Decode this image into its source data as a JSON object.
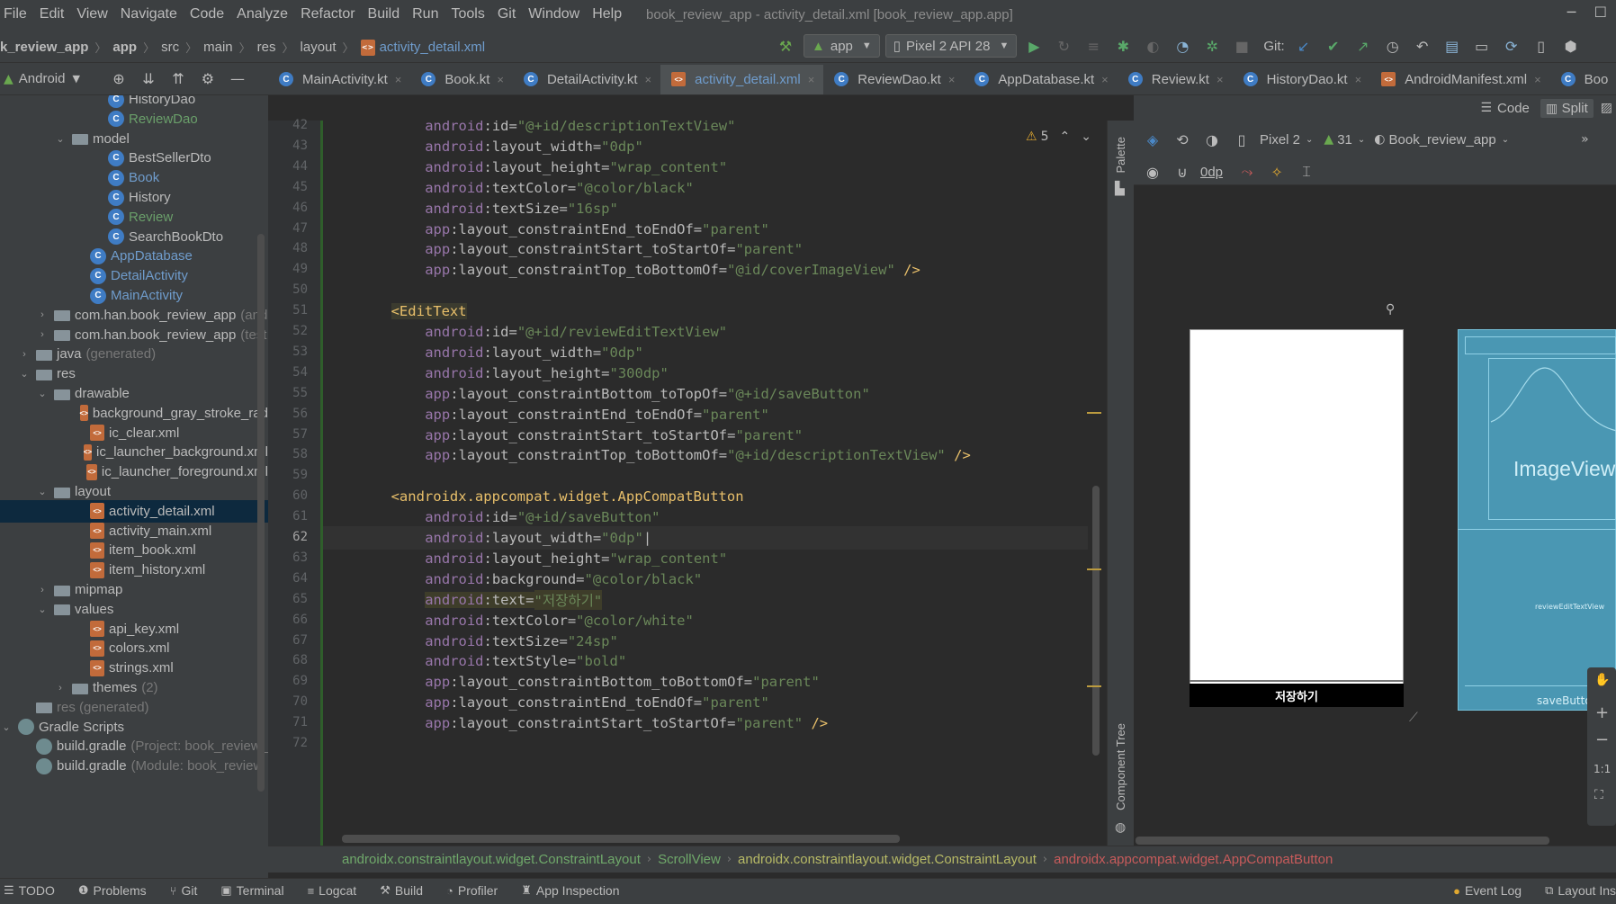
{
  "menu": [
    "File",
    "Edit",
    "View",
    "Navigate",
    "Code",
    "Analyze",
    "Refactor",
    "Build",
    "Run",
    "Tools",
    "Git",
    "Window",
    "Help"
  ],
  "window_title": "book_review_app - activity_detail.xml [book_review_app.app]",
  "breadcrumb": [
    "k_review_app",
    "app",
    "src",
    "main",
    "res",
    "layout",
    "activity_detail.xml"
  ],
  "toolbar": {
    "run_config": "app",
    "device": "Pixel 2 API 28",
    "git_label": "Git:"
  },
  "project_panel": {
    "view_label": "Android"
  },
  "tree": [
    {
      "depth": 4,
      "arrow": "",
      "icon": "kt",
      "label": "HistoryDao",
      "style": ""
    },
    {
      "depth": 4,
      "arrow": "",
      "icon": "kt",
      "label": "ReviewDao",
      "style": "green"
    },
    {
      "depth": 2,
      "arrow": "v",
      "icon": "folder",
      "label": "model",
      "style": ""
    },
    {
      "depth": 4,
      "arrow": "",
      "icon": "kt",
      "label": "BestSellerDto",
      "style": ""
    },
    {
      "depth": 4,
      "arrow": "",
      "icon": "kt",
      "label": "Book",
      "style": "blue"
    },
    {
      "depth": 4,
      "arrow": "",
      "icon": "kt",
      "label": "History",
      "style": ""
    },
    {
      "depth": 4,
      "arrow": "",
      "icon": "kt",
      "label": "Review",
      "style": "green"
    },
    {
      "depth": 4,
      "arrow": "",
      "icon": "kt",
      "label": "SearchBookDto",
      "style": ""
    },
    {
      "depth": 3,
      "arrow": "",
      "icon": "kt",
      "label": "AppDatabase",
      "style": "blue"
    },
    {
      "depth": 3,
      "arrow": "",
      "icon": "kt",
      "label": "DetailActivity",
      "style": "blue"
    },
    {
      "depth": 3,
      "arrow": "",
      "icon": "kt",
      "label": "MainActivity",
      "style": "blue"
    },
    {
      "depth": 1,
      "arrow": ">",
      "icon": "folder",
      "label": "com.han.book_review_app",
      "suffix": "(and",
      "style": ""
    },
    {
      "depth": 1,
      "arrow": ">",
      "icon": "folder",
      "label": "com.han.book_review_app",
      "suffix": "(test",
      "style": ""
    },
    {
      "depth": 0,
      "arrow": ">",
      "icon": "folder",
      "label": "java",
      "suffix": "(generated)",
      "style": ""
    },
    {
      "depth": 0,
      "arrow": "v",
      "icon": "folder",
      "label": "res",
      "style": ""
    },
    {
      "depth": 1,
      "arrow": "v",
      "icon": "folder",
      "label": "drawable",
      "style": ""
    },
    {
      "depth": 3,
      "arrow": "",
      "icon": "xml",
      "label": "background_gray_stroke_rad",
      "style": ""
    },
    {
      "depth": 3,
      "arrow": "",
      "icon": "xml",
      "label": "ic_clear.xml",
      "style": ""
    },
    {
      "depth": 3,
      "arrow": "",
      "icon": "xml",
      "label": "ic_launcher_background.xml",
      "style": ""
    },
    {
      "depth": 3,
      "arrow": "",
      "icon": "xml",
      "label": "ic_launcher_foreground.xml",
      "style": ""
    },
    {
      "depth": 1,
      "arrow": "v",
      "icon": "folder",
      "label": "layout",
      "style": ""
    },
    {
      "depth": 3,
      "arrow": "",
      "icon": "xml",
      "label": "activity_detail.xml",
      "style": "",
      "selected": true
    },
    {
      "depth": 3,
      "arrow": "",
      "icon": "xml",
      "label": "activity_main.xml",
      "style": ""
    },
    {
      "depth": 3,
      "arrow": "",
      "icon": "xml",
      "label": "item_book.xml",
      "style": ""
    },
    {
      "depth": 3,
      "arrow": "",
      "icon": "xml",
      "label": "item_history.xml",
      "style": ""
    },
    {
      "depth": 1,
      "arrow": ">",
      "icon": "folder",
      "label": "mipmap",
      "style": ""
    },
    {
      "depth": 1,
      "arrow": "v",
      "icon": "folder",
      "label": "values",
      "style": ""
    },
    {
      "depth": 3,
      "arrow": "",
      "icon": "xml",
      "label": "api_key.xml",
      "style": ""
    },
    {
      "depth": 3,
      "arrow": "",
      "icon": "xml",
      "label": "colors.xml",
      "style": ""
    },
    {
      "depth": 3,
      "arrow": "",
      "icon": "xml",
      "label": "strings.xml",
      "style": ""
    },
    {
      "depth": 2,
      "arrow": ">",
      "icon": "folder",
      "label": "themes",
      "suffix": "(2)",
      "style": ""
    },
    {
      "depth": 0,
      "arrow": "",
      "icon": "folder",
      "label": "res (generated)",
      "style": "gray"
    },
    {
      "depth": -1,
      "arrow": "v",
      "icon": "gradle",
      "label": "Gradle Scripts",
      "style": ""
    },
    {
      "depth": 0,
      "arrow": "",
      "icon": "gradle",
      "label": "build.gradle",
      "suffix": "(Project: book_review_",
      "style": ""
    },
    {
      "depth": 0,
      "arrow": "",
      "icon": "gradle",
      "label": "build.gradle",
      "suffix": "(Module: book_review",
      "style": ""
    }
  ],
  "tabs": [
    {
      "label": "MainActivity.kt",
      "icon": "kt"
    },
    {
      "label": "Book.kt",
      "icon": "kt"
    },
    {
      "label": "DetailActivity.kt",
      "icon": "kt"
    },
    {
      "label": "activity_detail.xml",
      "icon": "xml",
      "active": true
    },
    {
      "label": "ReviewDao.kt",
      "icon": "kt"
    },
    {
      "label": "AppDatabase.kt",
      "icon": "kt"
    },
    {
      "label": "Review.kt",
      "icon": "kt"
    },
    {
      "label": "HistoryDao.kt",
      "icon": "kt"
    },
    {
      "label": "AndroidManifest.xml",
      "icon": "xml"
    },
    {
      "label": "Boo",
      "icon": "kt"
    }
  ],
  "view_modes": {
    "code": "Code",
    "split": "Split"
  },
  "editor": {
    "warning_count": "5",
    "current_line": 62,
    "lines": [
      {
        "n": 42,
        "indent": 8,
        "parts": [
          [
            "ns",
            "android"
          ],
          [
            "attr",
            ":id="
          ],
          [
            "val",
            "\"@+id/descriptionTextView\""
          ]
        ]
      },
      {
        "n": 43,
        "indent": 8,
        "parts": [
          [
            "ns",
            "android"
          ],
          [
            "attr",
            ":layout_width="
          ],
          [
            "val",
            "\"0dp\""
          ]
        ]
      },
      {
        "n": 44,
        "indent": 8,
        "parts": [
          [
            "ns",
            "android"
          ],
          [
            "attr",
            ":layout_height="
          ],
          [
            "val",
            "\"wrap_content\""
          ]
        ]
      },
      {
        "n": 45,
        "indent": 8,
        "parts": [
          [
            "ns",
            "android"
          ],
          [
            "attr",
            ":textColor="
          ],
          [
            "val",
            "\"@color/black\""
          ]
        ]
      },
      {
        "n": 46,
        "indent": 8,
        "parts": [
          [
            "ns",
            "android"
          ],
          [
            "attr",
            ":textSize="
          ],
          [
            "val",
            "\"16sp\""
          ]
        ]
      },
      {
        "n": 47,
        "indent": 8,
        "parts": [
          [
            "ns",
            "app"
          ],
          [
            "attr",
            ":layout_constraintEnd_toEndOf="
          ],
          [
            "val",
            "\"parent\""
          ]
        ]
      },
      {
        "n": 48,
        "indent": 8,
        "parts": [
          [
            "ns",
            "app"
          ],
          [
            "attr",
            ":layout_constraintStart_toStartOf="
          ],
          [
            "val",
            "\"parent\""
          ]
        ]
      },
      {
        "n": 49,
        "indent": 8,
        "parts": [
          [
            "ns",
            "app"
          ],
          [
            "attr",
            ":layout_constraintTop_toBottomOf="
          ],
          [
            "val",
            "\"@id/coverImageView\""
          ],
          [
            "punct",
            " />"
          ]
        ]
      },
      {
        "n": 50,
        "indent": 0,
        "parts": []
      },
      {
        "n": 51,
        "indent": 4,
        "parts": [
          [
            "hl-tag",
            "<EditText"
          ]
        ]
      },
      {
        "n": 52,
        "indent": 8,
        "parts": [
          [
            "ns",
            "android"
          ],
          [
            "attr",
            ":id="
          ],
          [
            "val",
            "\"@+id/reviewEditTextView\""
          ]
        ]
      },
      {
        "n": 53,
        "indent": 8,
        "parts": [
          [
            "ns",
            "android"
          ],
          [
            "attr",
            ":layout_width="
          ],
          [
            "val",
            "\"0dp\""
          ]
        ]
      },
      {
        "n": 54,
        "indent": 8,
        "parts": [
          [
            "ns",
            "android"
          ],
          [
            "attr",
            ":layout_height="
          ],
          [
            "val",
            "\"300dp\""
          ]
        ]
      },
      {
        "n": 55,
        "indent": 8,
        "parts": [
          [
            "ns",
            "app"
          ],
          [
            "attr",
            ":layout_constraintBottom_toTopOf="
          ],
          [
            "val",
            "\"@+id/saveButton\""
          ]
        ]
      },
      {
        "n": 56,
        "indent": 8,
        "parts": [
          [
            "ns",
            "app"
          ],
          [
            "attr",
            ":layout_constraintEnd_toEndOf="
          ],
          [
            "val",
            "\"parent\""
          ]
        ]
      },
      {
        "n": 57,
        "indent": 8,
        "parts": [
          [
            "ns",
            "app"
          ],
          [
            "attr",
            ":layout_constraintStart_toStartOf="
          ],
          [
            "val",
            "\"parent\""
          ]
        ]
      },
      {
        "n": 58,
        "indent": 8,
        "parts": [
          [
            "ns",
            "app"
          ],
          [
            "attr",
            ":layout_constraintTop_toBottomOf="
          ],
          [
            "val",
            "\"@+id/descriptionTextView\""
          ],
          [
            "punct",
            " />"
          ]
        ]
      },
      {
        "n": 59,
        "indent": 0,
        "parts": []
      },
      {
        "n": 60,
        "indent": 4,
        "parts": [
          [
            "tag",
            "<androidx.appcompat.widget.AppCompatButton"
          ]
        ]
      },
      {
        "n": 61,
        "indent": 8,
        "parts": [
          [
            "ns",
            "android"
          ],
          [
            "attr",
            ":id="
          ],
          [
            "val",
            "\"@+id/saveButton\""
          ]
        ]
      },
      {
        "n": 62,
        "indent": 8,
        "parts": [
          [
            "ns",
            "android"
          ],
          [
            "attr",
            ":layout_width="
          ],
          [
            "val",
            "\"0dp\""
          ],
          [
            "attr",
            "|"
          ]
        ]
      },
      {
        "n": 63,
        "indent": 8,
        "parts": [
          [
            "ns",
            "android"
          ],
          [
            "attr",
            ":layout_height="
          ],
          [
            "val",
            "\"wrap_content\""
          ]
        ]
      },
      {
        "n": 64,
        "indent": 8,
        "parts": [
          [
            "ns",
            "android"
          ],
          [
            "attr",
            ":background="
          ],
          [
            "val",
            "\"@color/black\""
          ]
        ]
      },
      {
        "n": 65,
        "indent": 8,
        "parts": [
          [
            "ns",
            "android"
          ],
          [
            "attr",
            ":text="
          ],
          [
            "val",
            "\"저장하기\""
          ]
        ],
        "highlight": true
      },
      {
        "n": 66,
        "indent": 8,
        "parts": [
          [
            "ns",
            "android"
          ],
          [
            "attr",
            ":textColor="
          ],
          [
            "val",
            "\"@color/white\""
          ]
        ]
      },
      {
        "n": 67,
        "indent": 8,
        "parts": [
          [
            "ns",
            "android"
          ],
          [
            "attr",
            ":textSize="
          ],
          [
            "val",
            "\"24sp\""
          ]
        ]
      },
      {
        "n": 68,
        "indent": 8,
        "parts": [
          [
            "ns",
            "android"
          ],
          [
            "attr",
            ":textStyle="
          ],
          [
            "val",
            "\"bold\""
          ]
        ]
      },
      {
        "n": 69,
        "indent": 8,
        "parts": [
          [
            "ns",
            "app"
          ],
          [
            "attr",
            ":layout_constraintBottom_toBottomOf="
          ],
          [
            "val",
            "\"parent\""
          ]
        ]
      },
      {
        "n": 70,
        "indent": 8,
        "parts": [
          [
            "ns",
            "app"
          ],
          [
            "attr",
            ":layout_constraintEnd_toEndOf="
          ],
          [
            "val",
            "\"parent\""
          ]
        ]
      },
      {
        "n": 71,
        "indent": 8,
        "parts": [
          [
            "ns",
            "app"
          ],
          [
            "attr",
            ":layout_constraintStart_toStartOf="
          ],
          [
            "val",
            "\"parent\""
          ],
          [
            "punct",
            " />"
          ]
        ]
      },
      {
        "n": 72,
        "indent": 0,
        "parts": []
      }
    ]
  },
  "design": {
    "device": "Pixel 2",
    "api": "31",
    "theme": "Book_review_app",
    "margin": "0dp",
    "preview_button_text": "저장하기",
    "blueprint_image_label": "ImageView",
    "blueprint_edittext_label": "reviewEditTextView",
    "blueprint_save_label": "saveButton"
  },
  "side_labels": {
    "palette": "Palette",
    "component_tree": "Component Tree"
  },
  "bottom_crumbs": [
    {
      "label": "androidx.constraintlayout.widget.ConstraintLayout",
      "color": "#6fa86a"
    },
    {
      "label": "ScrollView",
      "color": "#6fa86a"
    },
    {
      "label": "androidx.constraintlayout.widget.ConstraintLayout",
      "color": "#b7ba66"
    },
    {
      "label": "androidx.appcompat.widget.AppCompatButton",
      "color": "#c75b5b"
    }
  ],
  "status_bar": {
    "items": [
      "TODO",
      "Problems",
      "Git",
      "Terminal",
      "Logcat",
      "Build",
      "Profiler",
      "App Inspection"
    ],
    "right": [
      "Event Log",
      "Layout Ins"
    ]
  }
}
